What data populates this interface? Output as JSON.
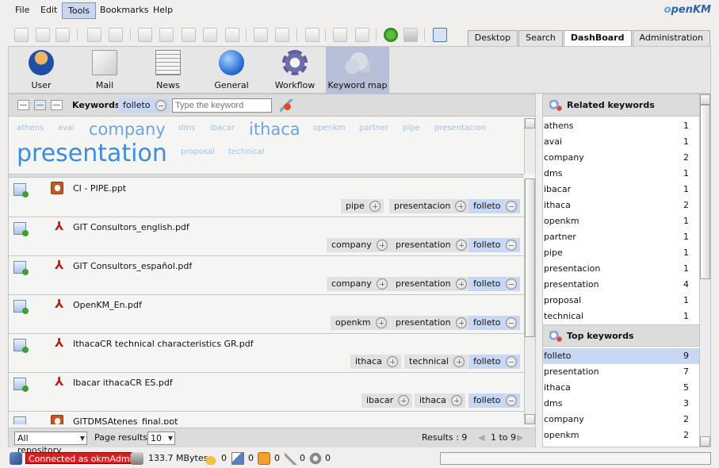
{
  "menu": [
    "File",
    "Edit",
    "Tools",
    "Bookmarks",
    "Help"
  ],
  "active_menu": "Tools",
  "logo": {
    "prefix": "o",
    "text": "penKM"
  },
  "tabs": [
    "Desktop",
    "Search",
    "DashBoard",
    "Administration"
  ],
  "active_tab": "DashBoard",
  "dash_tools": [
    {
      "label": "User",
      "icon": "user-icon"
    },
    {
      "label": "Mail",
      "icon": "mail-icon"
    },
    {
      "label": "News",
      "icon": "news-icon"
    },
    {
      "label": "General",
      "icon": "general-globe-icon"
    },
    {
      "label": "Workflow",
      "icon": "workflow-gear-icon"
    },
    {
      "label": "Keyword map",
      "icon": "keyword-map-cloud-icon"
    }
  ],
  "active_dash_tool": "Keyword map",
  "keywords_bar": {
    "label": "Keywords",
    "selected_chip": "folleto",
    "input_placeholder": "Type the keyword"
  },
  "tag_cloud": {
    "athens": "athens",
    "avai": "avai",
    "company": "company",
    "dms": "dms",
    "ibacar": "ibacar",
    "ithaca": "ithaca",
    "openkm": "openkm",
    "partner": "partner",
    "pipe": "pipe",
    "presentacion": "presentacion",
    "presentation": "presentation",
    "proposal": "proposal",
    "technical": "technical"
  },
  "documents": [
    {
      "name": "CI - PIPE.ppt",
      "type": "ppt",
      "tags": [
        "pipe",
        "presentacion"
      ],
      "selected": "folleto"
    },
    {
      "name": "GIT Consultors_english.pdf",
      "type": "pdf",
      "tags": [
        "company",
        "presentation"
      ],
      "selected": "folleto"
    },
    {
      "name": "GIT Consultors_español.pdf",
      "type": "pdf",
      "tags": [
        "company",
        "presentation"
      ],
      "selected": "folleto"
    },
    {
      "name": "OpenKM_En.pdf",
      "type": "pdf",
      "tags": [
        "openkm",
        "presentation"
      ],
      "selected": "folleto"
    },
    {
      "name": "IthacaCR technical characteristics GR.pdf",
      "type": "pdf",
      "tags": [
        "ithaca",
        "technical"
      ],
      "selected": "folleto"
    },
    {
      "name": "Ibacar ithacaCR ES.pdf",
      "type": "pdf",
      "tags": [
        "ibacar",
        "ithaca"
      ],
      "selected": "folleto"
    },
    {
      "name": "GITDMSAtenes_final.ppt",
      "type": "ppt",
      "tags": [],
      "selected": ""
    }
  ],
  "footer": {
    "repository": "All repository",
    "page_results_label": "Page results",
    "page_results_value": "10",
    "results": "Results : 9",
    "range": "1 to 9"
  },
  "related_keywords": {
    "title": "Related keywords",
    "items": [
      {
        "k": "athens",
        "c": "1"
      },
      {
        "k": "avai",
        "c": "1"
      },
      {
        "k": "company",
        "c": "2"
      },
      {
        "k": "dms",
        "c": "1"
      },
      {
        "k": "ibacar",
        "c": "1"
      },
      {
        "k": "ithaca",
        "c": "2"
      },
      {
        "k": "openkm",
        "c": "1"
      },
      {
        "k": "partner",
        "c": "1"
      },
      {
        "k": "pipe",
        "c": "1"
      },
      {
        "k": "presentacion",
        "c": "1"
      },
      {
        "k": "presentation",
        "c": "4"
      },
      {
        "k": "proposal",
        "c": "1"
      },
      {
        "k": "technical",
        "c": "1"
      }
    ]
  },
  "top_keywords": {
    "title": "Top keywords",
    "items": [
      {
        "k": "folleto",
        "c": "9"
      },
      {
        "k": "presentation",
        "c": "7"
      },
      {
        "k": "ithaca",
        "c": "5"
      },
      {
        "k": "dms",
        "c": "3"
      },
      {
        "k": "company",
        "c": "2"
      },
      {
        "k": "openkm",
        "c": "2"
      }
    ],
    "selected": "folleto"
  },
  "status": {
    "connected": "Connected as okmAdmin",
    "size": "133.7 MBytes",
    "locked": "0",
    "checkout": "0",
    "mail": "0",
    "subscribed": "0",
    "workflow": "0"
  }
}
